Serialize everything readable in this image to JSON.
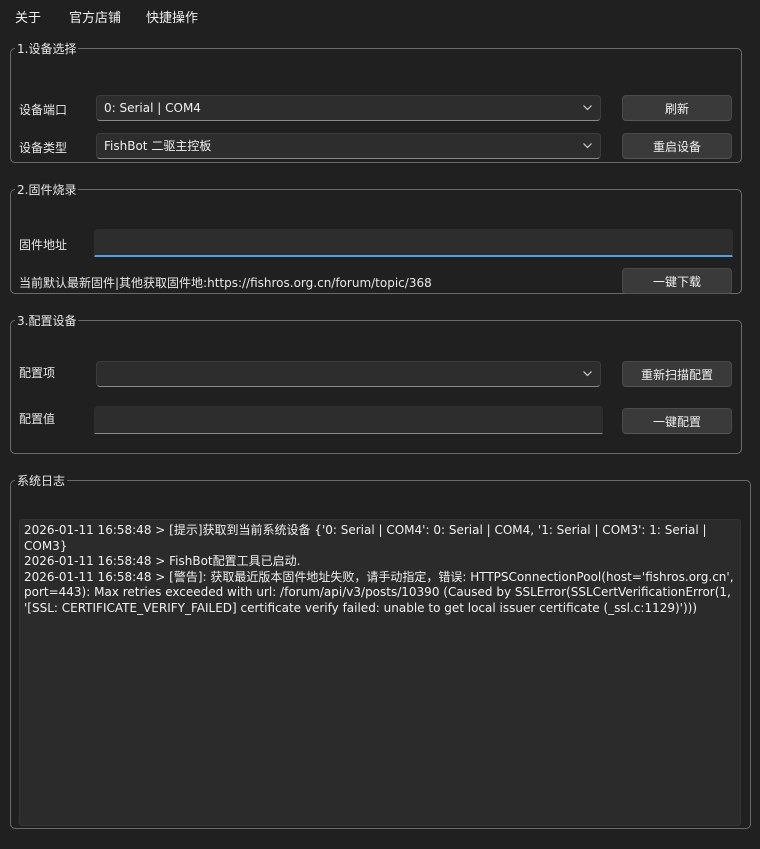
{
  "menu": {
    "about": "关于",
    "store": "官方店铺",
    "shortcuts": "快捷操作"
  },
  "device_select": {
    "title": "1.设备选择",
    "port_label": "设备端口",
    "port_value": "0: Serial | COM4",
    "type_label": "设备类型",
    "type_value": "FishBot 二驱主控板",
    "refresh_button": "刷新",
    "restart_button": "重启设备"
  },
  "firmware": {
    "title": "2.固件烧录",
    "address_label": "固件地址",
    "address_value": "",
    "hint": "当前默认最新固件|其他获取固件地:https://fishros.org.cn/forum/topic/368",
    "download_button": "一键下载"
  },
  "config": {
    "title": "3.配置设备",
    "item_label": "配置项",
    "item_value": "",
    "value_label": "配置值",
    "value_value": "",
    "rescan_button": "重新扫描配置",
    "apply_button": "一键配置"
  },
  "log": {
    "title": "系统日志",
    "lines": [
      "2026-01-11 16:58:48 > [提示]获取到当前系统设备 {'0: Serial | COM4': 0: Serial | COM4, '1: Serial | COM3': 1: Serial | COM3}",
      "2026-01-11 16:58:48 > FishBot配置工具已启动.",
      "2026-01-11 16:58:48 > [警告]: 获取最近版本固件地址失败，请手动指定，错误: HTTPSConnectionPool(host='fishros.org.cn', port=443): Max retries exceeded with url: /forum/api/v3/posts/10390 (Caused by SSLError(SSLCertVerificationError(1, '[SSL: CERTIFICATE_VERIFY_FAILED] certificate verify failed: unable to get local issuer certificate (_ssl.c:1129)')))"
    ]
  }
}
